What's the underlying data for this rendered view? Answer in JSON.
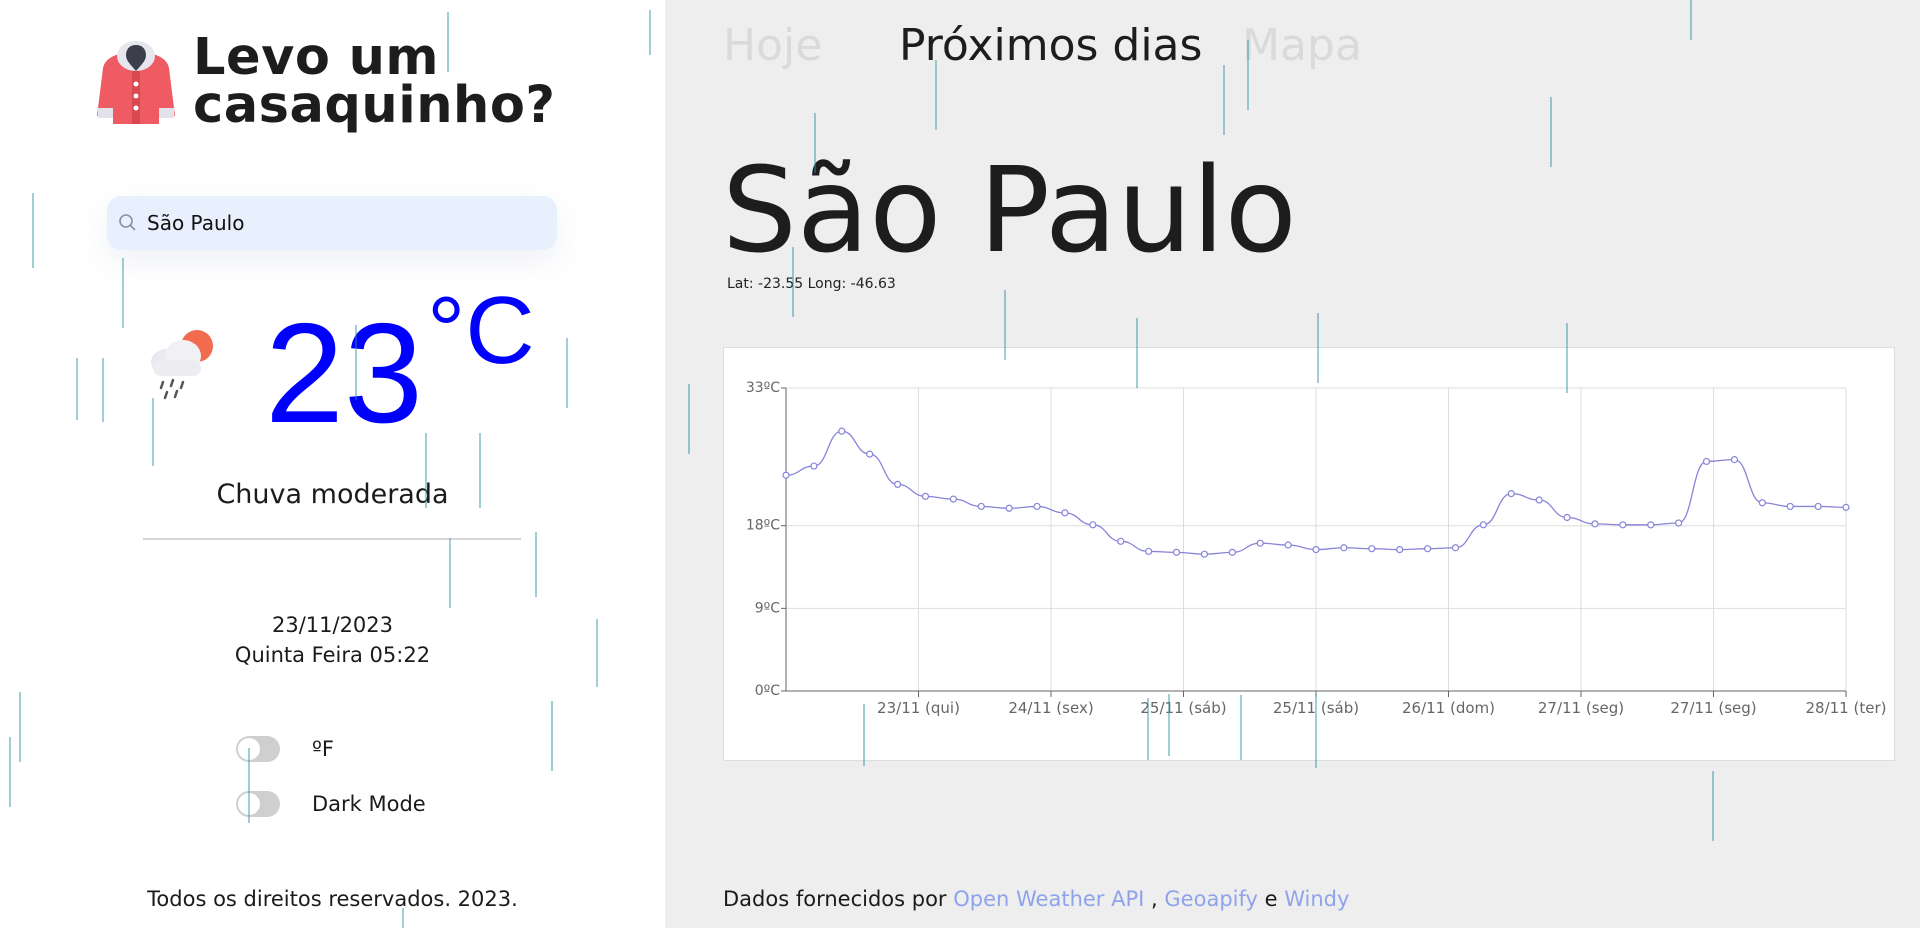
{
  "app": {
    "title_line1": "Levo um",
    "title_line2": "casaquinho?",
    "logo_icon": "jacket-icon"
  },
  "search": {
    "value": "São Paulo",
    "icon": "search-icon"
  },
  "current": {
    "temperature": "23",
    "unit": "°C",
    "icon": "cloud-rain-sun-icon",
    "description": "Chuva moderada",
    "date": "23/11/2023",
    "weekday_time": "Quinta Feira 05:22"
  },
  "toggles": [
    {
      "label": "ºF",
      "on": false
    },
    {
      "label": "Dark Mode",
      "on": false
    }
  ],
  "footer_left": "Todos os direitos reservados. 2023.",
  "tabs": [
    {
      "label": "Hoje",
      "active": false
    },
    {
      "label": "Próximos dias",
      "active": true
    },
    {
      "label": "Mapa",
      "active": false
    }
  ],
  "city": "São Paulo",
  "coords": "Lat: -23.55 Long: -46.63",
  "credits": {
    "prefix": "Dados fornecidos por",
    "link1": "Open Weather API",
    "sep1": ",",
    "link2": "Geoapify",
    "sep2": "e",
    "link3": "Windy"
  },
  "colors": {
    "temperature": "#0000ff",
    "line": "#8884d8",
    "link": "#8fa3ec",
    "main_bg": "#eeeeee",
    "search_bg": "#e8effd"
  },
  "chart_data": {
    "type": "line",
    "ylim": [
      0,
      33
    ],
    "ytick_values": [
      0,
      9,
      18,
      33
    ],
    "yticks": [
      "0ºC",
      "9ºC",
      "18ºC",
      "33ºC"
    ],
    "xticks": [
      "23/11 (qui)",
      "24/11 (sex)",
      "25/11 (sáb)",
      "25/11 (sáb)",
      "26/11 (dom)",
      "27/11 (seg)",
      "27/11 (seg)",
      "28/11 (ter)"
    ],
    "grid": true,
    "series": [
      {
        "values": [
          23.5,
          24.5,
          28.3,
          25.8,
          22.5,
          21.2,
          20.9,
          20.1,
          19.9,
          20.1,
          19.4,
          18.1,
          16.3,
          15.2,
          15.1,
          14.9,
          15.1,
          16.1,
          15.9,
          15.4,
          15.6,
          15.5,
          15.4,
          15.5,
          15.6,
          18.1,
          21.5,
          20.8,
          18.9,
          18.2,
          18.1,
          18.1,
          18.3,
          25.0,
          25.2,
          20.5,
          20.1,
          20.1,
          20.0
        ]
      }
    ]
  }
}
